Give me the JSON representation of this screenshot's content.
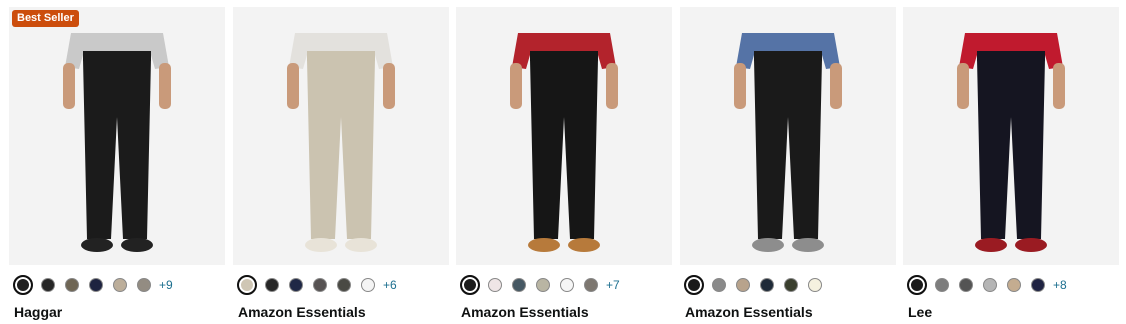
{
  "products": [
    {
      "brand": "Haggar",
      "badge": "Best Seller",
      "more_colors": "+9",
      "swatches": [
        "#1f1f1f",
        "#262626",
        "#6f6655",
        "#1e2340",
        "#bcae9a",
        "#938c82"
      ],
      "pants_color": "#1b1b1b",
      "shirt_color": "#c9c9c9",
      "shoe_color": "#222222"
    },
    {
      "brand": "Amazon Essentials",
      "badge": "",
      "more_colors": "+6",
      "swatches": [
        "#cfc6b4",
        "#262626",
        "#1f2846",
        "#575353",
        "#4a4a44",
        "#f4f4f4"
      ],
      "pants_color": "#cbc3b0",
      "shirt_color": "#e3e1dd",
      "shoe_color": "#e8e3d8"
    },
    {
      "brand": "Amazon Essentials",
      "badge": "",
      "more_colors": "+7",
      "swatches": [
        "#1c1c1c",
        "#efe5e6",
        "#465863",
        "#b9b5a3",
        "#f6f6f6",
        "#7d7770"
      ],
      "pants_color": "#161616",
      "shirt_color": "#b3232c",
      "shoe_color": "#b77a3b"
    },
    {
      "brand": "Amazon Essentials",
      "badge": "",
      "more_colors": "",
      "swatches": [
        "#1a1a1a",
        "#8a8a8a",
        "#b8a38c",
        "#1f2a38",
        "#3a3f2e",
        "#f5f1df"
      ],
      "pants_color": "#1a1a1a",
      "shirt_color": "#5573a6",
      "shoe_color": "#8d8d8d"
    },
    {
      "brand": "Lee",
      "badge": "",
      "more_colors": "+8",
      "swatches": [
        "#1b1b1b",
        "#7d7d7d",
        "#545454",
        "#b5b5b5",
        "#c4ac90",
        "#1f2342"
      ],
      "pants_color": "#151521",
      "shirt_color": "#c01a2e",
      "shoe_color": "#9a1b22"
    }
  ]
}
